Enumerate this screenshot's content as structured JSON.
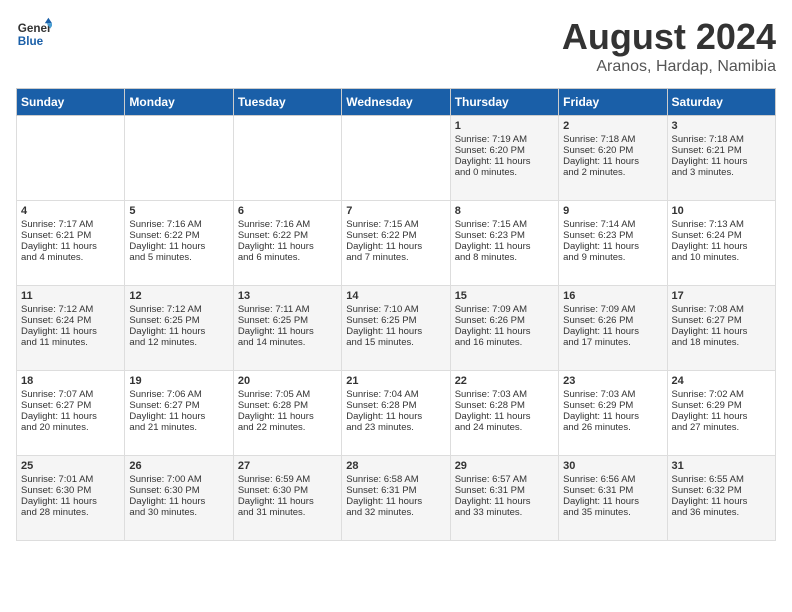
{
  "header": {
    "logo_line1": "General",
    "logo_line2": "Blue",
    "main_title": "August 2024",
    "subtitle": "Aranos, Hardap, Namibia"
  },
  "days_of_week": [
    "Sunday",
    "Monday",
    "Tuesday",
    "Wednesday",
    "Thursday",
    "Friday",
    "Saturday"
  ],
  "weeks": [
    [
      {
        "day": "",
        "content": ""
      },
      {
        "day": "",
        "content": ""
      },
      {
        "day": "",
        "content": ""
      },
      {
        "day": "",
        "content": ""
      },
      {
        "day": "1",
        "content": "Sunrise: 7:19 AM\nSunset: 6:20 PM\nDaylight: 11 hours\nand 0 minutes."
      },
      {
        "day": "2",
        "content": "Sunrise: 7:18 AM\nSunset: 6:20 PM\nDaylight: 11 hours\nand 2 minutes."
      },
      {
        "day": "3",
        "content": "Sunrise: 7:18 AM\nSunset: 6:21 PM\nDaylight: 11 hours\nand 3 minutes."
      }
    ],
    [
      {
        "day": "4",
        "content": "Sunrise: 7:17 AM\nSunset: 6:21 PM\nDaylight: 11 hours\nand 4 minutes."
      },
      {
        "day": "5",
        "content": "Sunrise: 7:16 AM\nSunset: 6:22 PM\nDaylight: 11 hours\nand 5 minutes."
      },
      {
        "day": "6",
        "content": "Sunrise: 7:16 AM\nSunset: 6:22 PM\nDaylight: 11 hours\nand 6 minutes."
      },
      {
        "day": "7",
        "content": "Sunrise: 7:15 AM\nSunset: 6:22 PM\nDaylight: 11 hours\nand 7 minutes."
      },
      {
        "day": "8",
        "content": "Sunrise: 7:15 AM\nSunset: 6:23 PM\nDaylight: 11 hours\nand 8 minutes."
      },
      {
        "day": "9",
        "content": "Sunrise: 7:14 AM\nSunset: 6:23 PM\nDaylight: 11 hours\nand 9 minutes."
      },
      {
        "day": "10",
        "content": "Sunrise: 7:13 AM\nSunset: 6:24 PM\nDaylight: 11 hours\nand 10 minutes."
      }
    ],
    [
      {
        "day": "11",
        "content": "Sunrise: 7:12 AM\nSunset: 6:24 PM\nDaylight: 11 hours\nand 11 minutes."
      },
      {
        "day": "12",
        "content": "Sunrise: 7:12 AM\nSunset: 6:25 PM\nDaylight: 11 hours\nand 12 minutes."
      },
      {
        "day": "13",
        "content": "Sunrise: 7:11 AM\nSunset: 6:25 PM\nDaylight: 11 hours\nand 14 minutes."
      },
      {
        "day": "14",
        "content": "Sunrise: 7:10 AM\nSunset: 6:25 PM\nDaylight: 11 hours\nand 15 minutes."
      },
      {
        "day": "15",
        "content": "Sunrise: 7:09 AM\nSunset: 6:26 PM\nDaylight: 11 hours\nand 16 minutes."
      },
      {
        "day": "16",
        "content": "Sunrise: 7:09 AM\nSunset: 6:26 PM\nDaylight: 11 hours\nand 17 minutes."
      },
      {
        "day": "17",
        "content": "Sunrise: 7:08 AM\nSunset: 6:27 PM\nDaylight: 11 hours\nand 18 minutes."
      }
    ],
    [
      {
        "day": "18",
        "content": "Sunrise: 7:07 AM\nSunset: 6:27 PM\nDaylight: 11 hours\nand 20 minutes."
      },
      {
        "day": "19",
        "content": "Sunrise: 7:06 AM\nSunset: 6:27 PM\nDaylight: 11 hours\nand 21 minutes."
      },
      {
        "day": "20",
        "content": "Sunrise: 7:05 AM\nSunset: 6:28 PM\nDaylight: 11 hours\nand 22 minutes."
      },
      {
        "day": "21",
        "content": "Sunrise: 7:04 AM\nSunset: 6:28 PM\nDaylight: 11 hours\nand 23 minutes."
      },
      {
        "day": "22",
        "content": "Sunrise: 7:03 AM\nSunset: 6:28 PM\nDaylight: 11 hours\nand 24 minutes."
      },
      {
        "day": "23",
        "content": "Sunrise: 7:03 AM\nSunset: 6:29 PM\nDaylight: 11 hours\nand 26 minutes."
      },
      {
        "day": "24",
        "content": "Sunrise: 7:02 AM\nSunset: 6:29 PM\nDaylight: 11 hours\nand 27 minutes."
      }
    ],
    [
      {
        "day": "25",
        "content": "Sunrise: 7:01 AM\nSunset: 6:30 PM\nDaylight: 11 hours\nand 28 minutes."
      },
      {
        "day": "26",
        "content": "Sunrise: 7:00 AM\nSunset: 6:30 PM\nDaylight: 11 hours\nand 30 minutes."
      },
      {
        "day": "27",
        "content": "Sunrise: 6:59 AM\nSunset: 6:30 PM\nDaylight: 11 hours\nand 31 minutes."
      },
      {
        "day": "28",
        "content": "Sunrise: 6:58 AM\nSunset: 6:31 PM\nDaylight: 11 hours\nand 32 minutes."
      },
      {
        "day": "29",
        "content": "Sunrise: 6:57 AM\nSunset: 6:31 PM\nDaylight: 11 hours\nand 33 minutes."
      },
      {
        "day": "30",
        "content": "Sunrise: 6:56 AM\nSunset: 6:31 PM\nDaylight: 11 hours\nand 35 minutes."
      },
      {
        "day": "31",
        "content": "Sunrise: 6:55 AM\nSunset: 6:32 PM\nDaylight: 11 hours\nand 36 minutes."
      }
    ]
  ]
}
